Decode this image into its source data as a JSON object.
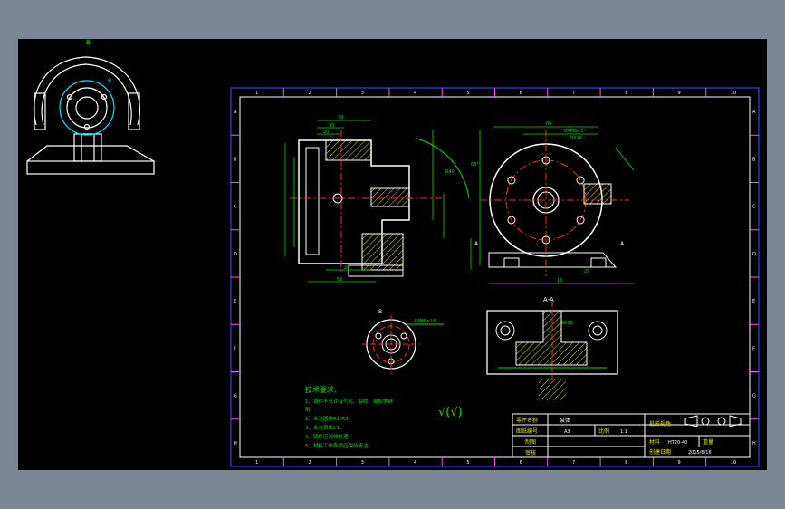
{
  "colors": {
    "background": "#000000",
    "viewport": "#7b8797",
    "frame": "#3a3aff",
    "outline": "#ffffff",
    "dimension": "#00e000",
    "centerline": "#ff2a2a",
    "hatch": "#e6e600",
    "tick": "#ff4dff",
    "annotation": "#00e5ff"
  },
  "preview": {
    "view_label": "B",
    "detail_label": "B"
  },
  "frame": {
    "col_numbers": [
      "1",
      "2",
      "3",
      "4",
      "5",
      "6",
      "7",
      "8",
      "9",
      "10"
    ],
    "row_letters": [
      "A",
      "B",
      "C",
      "D",
      "E",
      "F",
      "G",
      "H"
    ]
  },
  "views": {
    "section_label": "A-A",
    "detail_label": "B",
    "dim_left": "A",
    "dim_right": "A"
  },
  "dims": {
    "d78": "78",
    "d30": "30",
    "d20": "20",
    "d26": "26",
    "d56": "56",
    "d86": "86",
    "d8xm": "8XM8×1-",
    "d9x16": "9X16",
    "d63": "63°",
    "dR40": "R40",
    "d4xM8": "4XM8×16",
    "d6x10": "6X10",
    "d16": "16",
    "d25": "25"
  },
  "tech": {
    "title": "技术要求:",
    "lines": [
      "1、铸件不允许有气孔、裂纹、缩松等缺",
      "陷。",
      "2、未注圆角R1-R3。",
      "3、未注倒角C1。",
      "4、铸件应时效处理",
      "5、材料工作表面应保持清洁。"
    ]
  },
  "roughness_symbol": "√(√)",
  "title_block": {
    "part_name_label": "零件名称",
    "part_name": "泵体",
    "drawing_no_label": "图纸编号",
    "drawing_no": "A3",
    "scale_label": "比例",
    "scale": "1:1",
    "drawn_label": "制图",
    "checked_label": "审核",
    "projection_label": "投影视角",
    "material_label": "材料",
    "material": "HT20-40",
    "weight_label": "重量",
    "date_label": "创建日期",
    "date": "2015/6/16"
  }
}
